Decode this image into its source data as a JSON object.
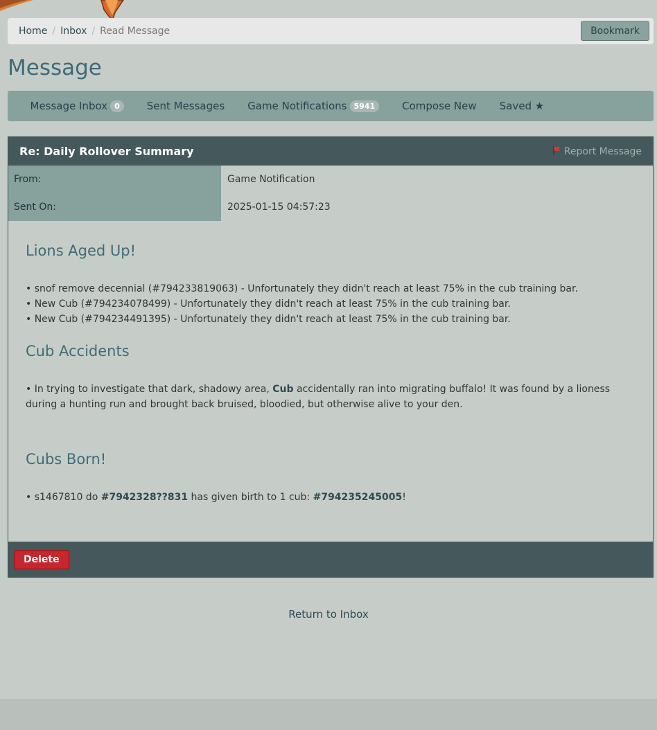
{
  "breadcrumb": {
    "items": [
      {
        "label": "Home"
      },
      {
        "label": "Inbox"
      }
    ],
    "current": "Read Message",
    "separator": "/"
  },
  "bookmark_label": "Bookmark",
  "page_title": "Message",
  "tabs": [
    {
      "label": "Message Inbox",
      "badge": "0"
    },
    {
      "label": "Sent Messages"
    },
    {
      "label": "Game Notifications",
      "badge": "5941"
    },
    {
      "label": "Compose New"
    },
    {
      "label": "Saved ★"
    }
  ],
  "message": {
    "subject": "Re: Daily Rollover Summary",
    "report_label": "Report Message",
    "from_label": "From:",
    "from_value": "Game Notification",
    "sent_label": "Sent On:",
    "sent_value": "2025-01-15 04:57:23",
    "sections": {
      "aged": {
        "heading": "Lions Aged Up!",
        "lines": [
          "• snof remove decennial (#794233819063) - Unfortunately they didn't reach at least 75% in the cub training bar.",
          "• New Cub (#794234078499) - Unfortunately they didn't reach at least 75% in the cub training bar.",
          "• New Cub (#794234491395) - Unfortunately they didn't reach at least 75% in the cub training bar."
        ]
      },
      "accidents": {
        "heading": "Cub Accidents",
        "text_before": "• In trying to investigate that dark, shadowy area, ",
        "link": "Cub",
        "text_after": " accidentally ran into migrating buffalo! It was found by a lioness during a hunting run and brought back bruised, bloodied, but otherwise alive to your den."
      },
      "born": {
        "heading": "Cubs Born!",
        "text_before": "• s1467810 do ",
        "parent_link": "#7942328??831",
        "text_middle": " has given birth to 1 cub: ",
        "cub_link": "#794235245005",
        "text_after": "!"
      }
    },
    "delete_label": "Delete"
  },
  "return_label": "Return to Inbox",
  "colors": {
    "background": "#c6cdc8",
    "header_dark": "#45585b",
    "nav": "#87a19d",
    "accent_title": "#3f6b75",
    "delete": "#c9252b"
  },
  "icons": [
    "flag-icon",
    "star-icon",
    "logo-fragment"
  ]
}
